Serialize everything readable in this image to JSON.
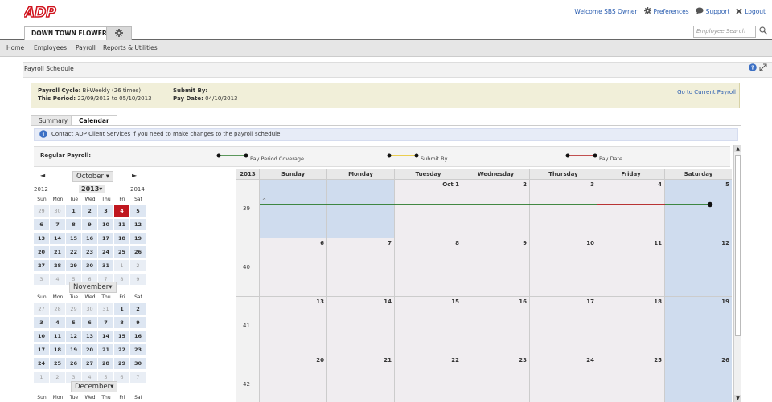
{
  "logo": "ADP",
  "toplinks": {
    "welcome": "Welcome SBS Owner",
    "preferences": "Preferences",
    "support": "Support",
    "logout": "Logout"
  },
  "company": "DOWN TOWN FLOWERS",
  "search_placeholder": "Employee Search",
  "nav": [
    "Home",
    "Employees",
    "Payroll",
    "Reports & Utilities"
  ],
  "page_title": "Payroll Schedule",
  "cycle": {
    "cycle_label": "Payroll Cycle:",
    "cycle_value": "Bi-Weekly (26 times)",
    "period_label": "This Period:",
    "period_value": "22/09/2013 to 05/10/2013",
    "submit_label": "Submit By:",
    "submit_value": "",
    "paydate_label": "Pay Date:",
    "paydate_value": "04/10/2013",
    "goto": "Go to Current Payroll"
  },
  "tabs": {
    "summary": "Summary",
    "calendar": "Calendar"
  },
  "info": "Contact ADP Client Services if you need to make changes to the payroll schedule.",
  "legend": {
    "label": "Regular Payroll:",
    "coverage": "Pay Period Coverage",
    "submit": "Submit By",
    "paydate": "Pay Date"
  },
  "colors": {
    "coverage": "#2a7a2a",
    "submit": "#e8c21a",
    "paydate": "#b01a1a",
    "accent": "#c0171f"
  },
  "mini": {
    "month": "October",
    "prev_year": "2012",
    "year": "2013",
    "next_year": "2014",
    "dow": [
      "Sun",
      "Mon",
      "Tue",
      "Wed",
      "Thu",
      "Fri",
      "Sat"
    ],
    "oct": [
      [
        "29",
        "30",
        "1",
        "2",
        "3",
        "4",
        "5"
      ],
      [
        "6",
        "7",
        "8",
        "9",
        "10",
        "11",
        "12"
      ],
      [
        "13",
        "14",
        "15",
        "16",
        "17",
        "18",
        "19"
      ],
      [
        "20",
        "21",
        "22",
        "23",
        "24",
        "25",
        "26"
      ],
      [
        "27",
        "28",
        "29",
        "30",
        "31",
        "1",
        "2"
      ],
      [
        "3",
        "4",
        "5",
        "6",
        "7",
        "8",
        "9"
      ]
    ],
    "nov_name": "November",
    "nov": [
      [
        "27",
        "28",
        "29",
        "30",
        "31",
        "1",
        "2"
      ],
      [
        "3",
        "4",
        "5",
        "6",
        "7",
        "8",
        "9"
      ],
      [
        "10",
        "11",
        "12",
        "13",
        "14",
        "15",
        "16"
      ],
      [
        "17",
        "18",
        "19",
        "20",
        "21",
        "22",
        "23"
      ],
      [
        "24",
        "25",
        "26",
        "27",
        "28",
        "29",
        "30"
      ],
      [
        "1",
        "2",
        "3",
        "4",
        "5",
        "6",
        "7"
      ]
    ],
    "dec_name": "December"
  },
  "calendar": {
    "year": "2013",
    "days": [
      "Sunday",
      "Monday",
      "Tuesday",
      "Wednesday",
      "Thursday",
      "Friday",
      "Saturday"
    ],
    "weeks": [
      {
        "num": "39",
        "dates": [
          "",
          "",
          "Oct 1",
          "2",
          "3",
          "4",
          "5"
        ]
      },
      {
        "num": "40",
        "dates": [
          "6",
          "7",
          "8",
          "9",
          "10",
          "11",
          "12"
        ]
      },
      {
        "num": "41",
        "dates": [
          "13",
          "14",
          "15",
          "16",
          "17",
          "18",
          "19"
        ]
      },
      {
        "num": "42",
        "dates": [
          "20",
          "21",
          "22",
          "23",
          "24",
          "25",
          "26"
        ]
      }
    ]
  }
}
